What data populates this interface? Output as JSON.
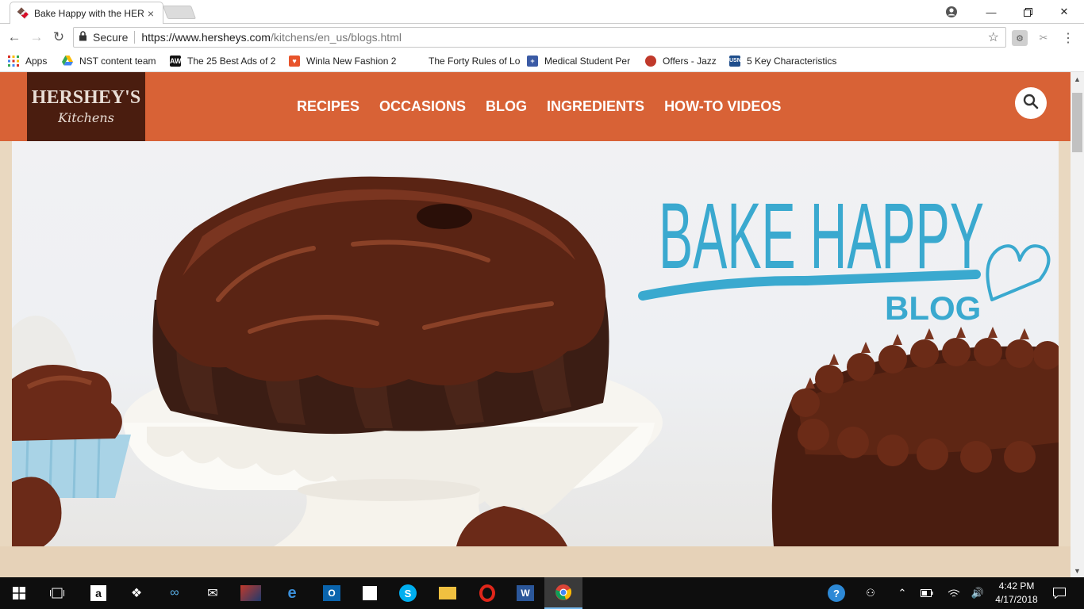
{
  "browser": {
    "tab_title": "Bake Happy with the HER",
    "url_secure_label": "Secure",
    "url_host": "https://www.hersheys.com",
    "url_path": "/kitchens/en_us/blogs.html"
  },
  "bookmarks": [
    {
      "label": "Apps",
      "icon": "apps-grid-icon",
      "color": "#d93025"
    },
    {
      "label": "NST content team",
      "icon": "google-drive-icon",
      "color": "#1a73e8"
    },
    {
      "label": "The 25 Best Ads of 2",
      "icon": "adweek-icon",
      "color": "#111111"
    },
    {
      "label": "Winla New Fashion 2",
      "icon": "winla-icon",
      "color": "#e8542b"
    },
    {
      "label": "The Forty Rules of Lo",
      "icon": "blank-icon",
      "color": "#ffffff"
    },
    {
      "label": "Medical Student Per",
      "icon": "medical-icon",
      "color": "#3b5ba5"
    },
    {
      "label": "Offers - Jazz",
      "icon": "jazz-icon",
      "color": "#c0392b"
    },
    {
      "label": "5 Key Characteristics",
      "icon": "usn-icon",
      "color": "#1f4e8c"
    }
  ],
  "site": {
    "logo_line1": "HERSHEY'S",
    "logo_line2": "Kitchens",
    "nav": [
      "RECIPES",
      "OCCASIONS",
      "BLOG",
      "INGREDIENTS",
      "HOW-TO VIDEOS"
    ],
    "hero": {
      "headline": "BAKE HAPPY",
      "subhead": "BLOG",
      "accent_color": "#3aa9cf"
    },
    "brand_color": "#d86236",
    "logo_bg": "#4a1d0f"
  },
  "taskbar": {
    "time": "4:42 PM",
    "date": "4/17/2018"
  }
}
